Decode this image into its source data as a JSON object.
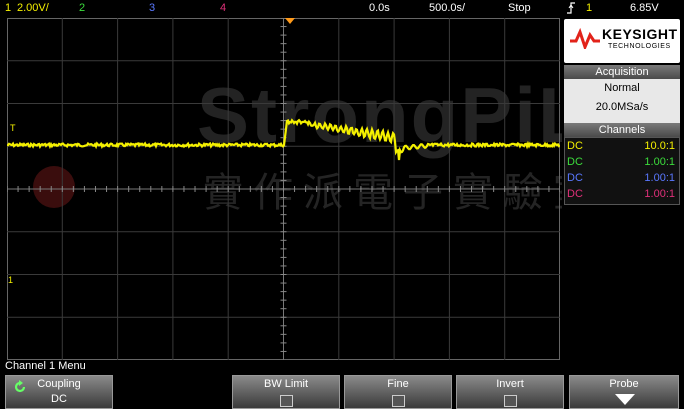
{
  "status_bar": {
    "ch1_num": "1",
    "ch1_scale": "2.00V/",
    "ch2_num": "2",
    "ch3_num": "3",
    "ch4_num": "4",
    "time_position": "0.0s",
    "time_scale": "500.0s/",
    "run_state": "Stop",
    "trigger_icon": "trigger-edge-icon",
    "trigger_source": "1",
    "trigger_level": "6.85V"
  },
  "brand": {
    "name": "KEYSIGHT",
    "sub": "TECHNOLOGIES"
  },
  "acquisition": {
    "header": "Acquisition",
    "mode": "Normal",
    "rate": "20.0MSa/s"
  },
  "channels": {
    "header": "Channels",
    "rows": [
      {
        "coupling": "DC",
        "probe": "10.0:1",
        "color": "#f4f000"
      },
      {
        "coupling": "DC",
        "probe": "1.00:1",
        "color": "#3cdc3c"
      },
      {
        "coupling": "DC",
        "probe": "1.00:1",
        "color": "#5a78ff"
      },
      {
        "coupling": "DC",
        "probe": "1.00:1",
        "color": "#e0307a"
      }
    ]
  },
  "screen": {
    "trigger_marker": "T",
    "ground_marker": "1",
    "watermark_text": "StrongPiLab",
    "watermark_cn": "實作派電子實驗室"
  },
  "menu": {
    "title": "Channel 1 Menu",
    "keys": [
      {
        "label": "Coupling",
        "value": "DC"
      },
      {
        "label": "BW Limit",
        "value": ""
      },
      {
        "label": "Fine",
        "value": ""
      },
      {
        "label": "Invert",
        "value": ""
      },
      {
        "label": "Probe",
        "value": ""
      }
    ]
  },
  "colors": {
    "ch1": "#f4f000",
    "ch2": "#3cdc3c",
    "ch3": "#5a78ff",
    "ch4": "#e0307a",
    "keysight_red": "#e2231a",
    "trigger_orange": "#ff9a1a"
  }
}
